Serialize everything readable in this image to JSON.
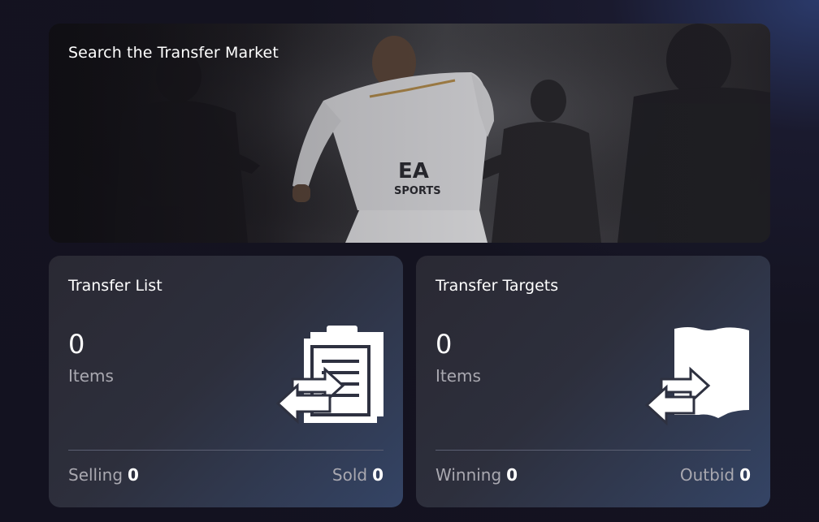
{
  "hero": {
    "title": "Search the Transfer Market"
  },
  "transfer_list": {
    "title": "Transfer List",
    "count": "0",
    "unit": "Items",
    "stat_left_label": "Selling",
    "stat_left_value": "0",
    "stat_right_label": "Sold",
    "stat_right_value": "0",
    "icon": "clipboard-transfer-icon"
  },
  "transfer_targets": {
    "title": "Transfer Targets",
    "count": "0",
    "unit": "Items",
    "stat_left_label": "Winning",
    "stat_left_value": "0",
    "stat_right_label": "Outbid",
    "stat_right_value": "0",
    "icon": "player-card-transfer-icon"
  },
  "colors": {
    "background": "#141320",
    "card": "#2d2f3c",
    "muted_text": "#a9a8b0"
  }
}
